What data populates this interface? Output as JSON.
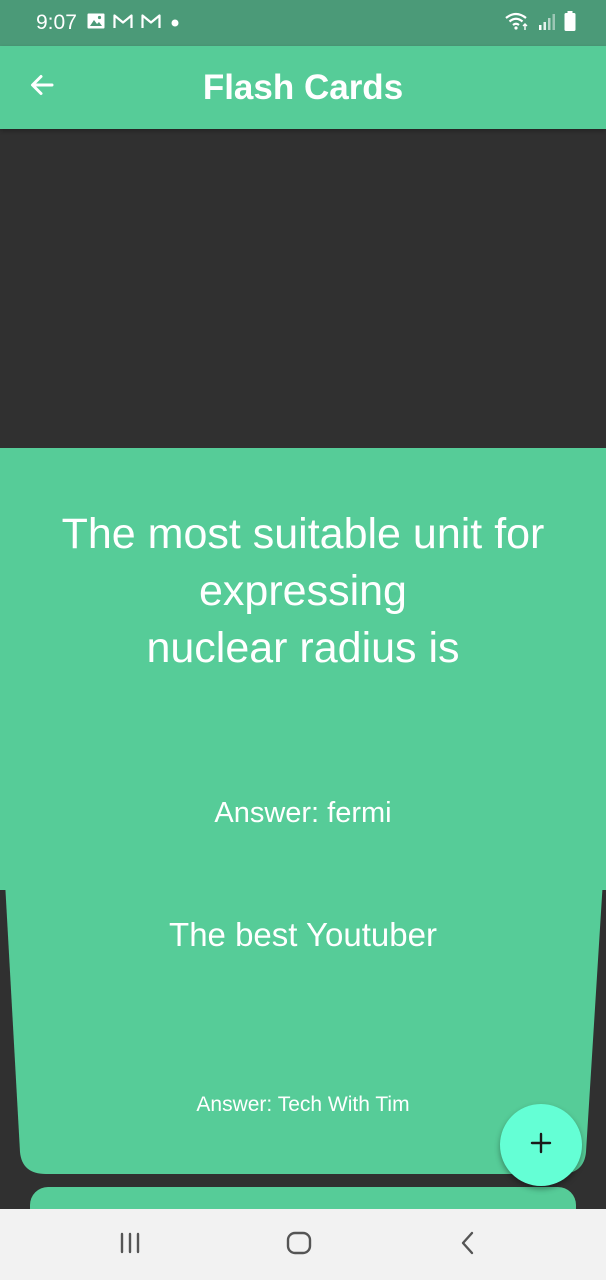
{
  "status_bar": {
    "time": "9:07",
    "left_icons": [
      "image-icon",
      "gmail-icon",
      "gmail-icon",
      "notification-dot-icon"
    ],
    "right_icons": [
      "wifi-icon",
      "signal-icon",
      "battery-icon"
    ]
  },
  "app_bar": {
    "title": "Flash Cards",
    "back_icon": "arrow-back-icon"
  },
  "cards": [
    {
      "question": "The most suitable unit for\nexpressing\nnuclear radius is",
      "answer": "Answer: fermi"
    },
    {
      "question": "The best Youtuber",
      "answer": "Answer: Tech With Tim"
    }
  ],
  "fab": {
    "icon": "plus-icon"
  },
  "nav_bar": {
    "recent_icon": "recent-apps-icon",
    "home_icon": "home-icon",
    "back_icon": "nav-back-icon"
  },
  "colors": {
    "primary": "#56cc98",
    "status_bar": "#4b9a78",
    "background": "#303030",
    "fab": "#64ffd5",
    "nav_bar": "#f2f2f2"
  }
}
